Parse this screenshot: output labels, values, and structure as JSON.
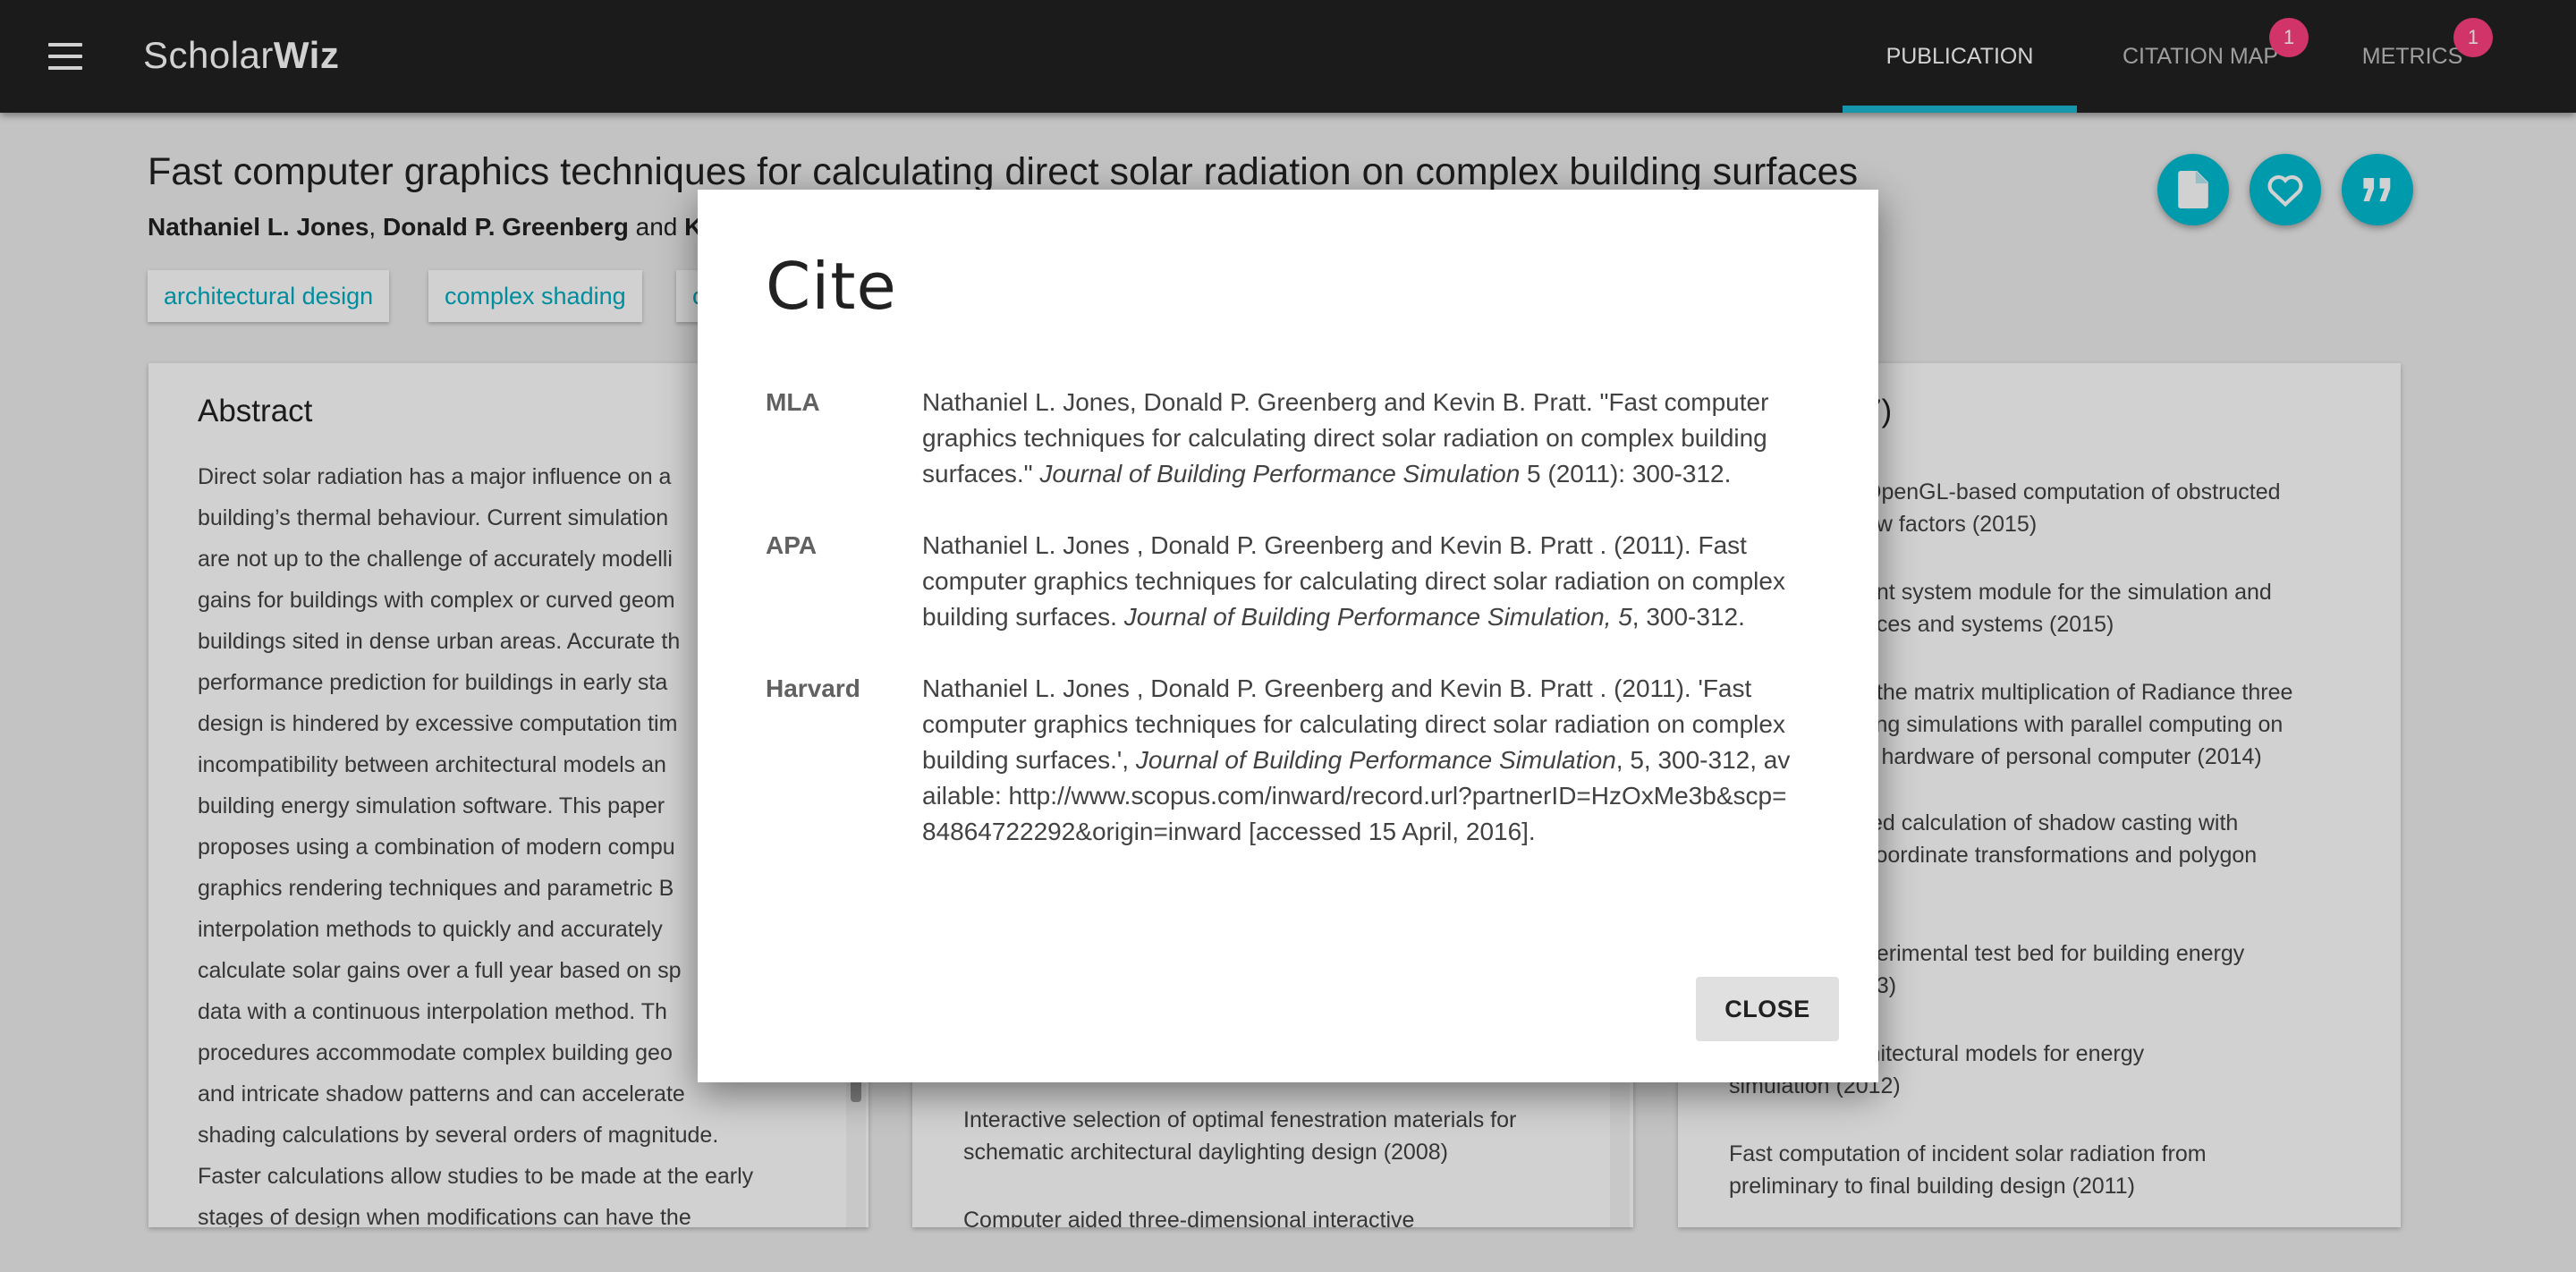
{
  "app": {
    "brand_light": "Scholar",
    "brand_bold": "Wiz"
  },
  "nav": {
    "tabs": [
      {
        "label": "PUBLICATION",
        "active": true
      },
      {
        "label": "CITATION MAP",
        "badge": "1"
      },
      {
        "label": "METRICS",
        "badge": "1"
      }
    ]
  },
  "publication": {
    "title": "Fast computer graphics techniques for calculating direct solar radiation on complex building surfaces",
    "authors": [
      "Nathaniel L. Jones",
      "Donald P. Greenberg"
    ],
    "authors_joiner": ", ",
    "authors_and": " and ",
    "authors_visible_tail": "K",
    "keywords": [
      "architectural design",
      "complex shading",
      "c"
    ],
    "actions": [
      {
        "name": "document-icon"
      },
      {
        "name": "heart-icon"
      },
      {
        "name": "quote-icon"
      }
    ]
  },
  "abstract": {
    "heading": "Abstract",
    "lines": [
      "Direct solar radiation has a major influence on a",
      "building’s thermal behaviour. Current simulation",
      "are not up to the challenge of accurately modelli",
      "gains for buildings with complex or curved geom",
      "buildings sited in dense urban areas. Accurate th",
      "performance prediction for buildings in early sta",
      "design is hindered by excessive computation tim",
      "incompatibility between architectural models an",
      "building energy simulation software. This paper",
      "proposes using a combination of modern compu",
      "graphics rendering techniques and parametric B",
      "interpolation methods to quickly and accurately",
      "calculate solar gains over a full year based on sp",
      "data with a continuous interpolation method. Th",
      "procedures accommodate complex building geo",
      "and intricate shadow patterns and can accelerate",
      "shading calculations by several orders of magnitude.",
      "Faster calculations allow studies to be made at the early",
      "stages of design when modifications can have the"
    ]
  },
  "middle_list": {
    "items": [
      "Interactive selection of optimal fenestration materials for schematic architectural daylighting design (2008)",
      "Computer aided three-dimensional interactive"
    ]
  },
  "right_list": {
    "heading_tail": "7)",
    "items": [
      "OpenGL-based computation of obstructed\new factors (2015)",
      "ant system module for the simulation and\naces and systems (2015)",
      "f the matrix multiplication of Radiance three\nting simulations with parallel computing on\ns hardware of personal computer (2014)",
      "ted calculation of shadow casting with\ncoordinate transformations and polygon\n)",
      "perimental test bed for building energy\n13)",
      "nslation of architectural models for energy\nsimulation (2012)",
      "Fast computation of incident solar radiation from\npreliminary to final building design (2011)"
    ]
  },
  "dialog": {
    "title": "Cite",
    "close_label": "CLOSE",
    "citations": [
      {
        "label": "MLA",
        "pre": "Nathaniel L. Jones, Donald P. Greenberg and Kevin B. Pratt. \"Fast computer graphics techniques for calculating direct solar radiation on complex building surfaces.\" ",
        "journal": "Journal of Building Performance Simulation",
        "post": " 5 (2011): 300-312."
      },
      {
        "label": "APA",
        "pre": "Nathaniel L. Jones , Donald P. Greenberg and Kevin B. Pratt . (2011). Fast computer graphics techniques for calculating direct solar radiation on complex building surfaces. ",
        "journal": "Journal of Building Performance Simulation, 5",
        "post": ", 300-312."
      },
      {
        "label": "Harvard",
        "pre": "Nathaniel L. Jones , Donald P. Greenberg and Kevin B. Pratt . (2011). 'Fast computer graphics techniques for calculating direct solar radiation on complex building surfaces.', ",
        "journal": "Journal of Building Performance Simulation",
        "post": ", 5, 300-312, available: http://www.scopus.com/inward/record.url?partnerID=HzOxMe3b&scp=84864722292&origin=inward [accessed 15 April, 2016]."
      }
    ]
  },
  "colors": {
    "appbar": "#212121",
    "accent": "#00bcd4",
    "badge": "#ff4081",
    "indicator": "#19b8d3"
  }
}
